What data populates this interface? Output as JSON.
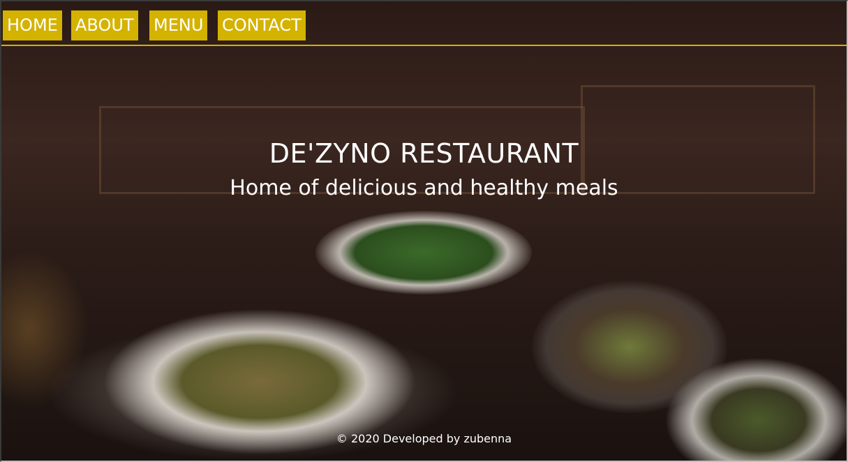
{
  "nav": {
    "items": [
      {
        "label": "HOME"
      },
      {
        "label": "ABOUT"
      },
      {
        "label": "MENU"
      },
      {
        "label": "CONTACT"
      }
    ]
  },
  "hero": {
    "title": "DE'ZYNO RESTAURANT",
    "subtitle": "Home of delicious and healthy meals"
  },
  "footer": {
    "text": "© 2020 Developed by zubenna"
  },
  "colors": {
    "accent": "#d4b200",
    "text": "#ffffff"
  }
}
